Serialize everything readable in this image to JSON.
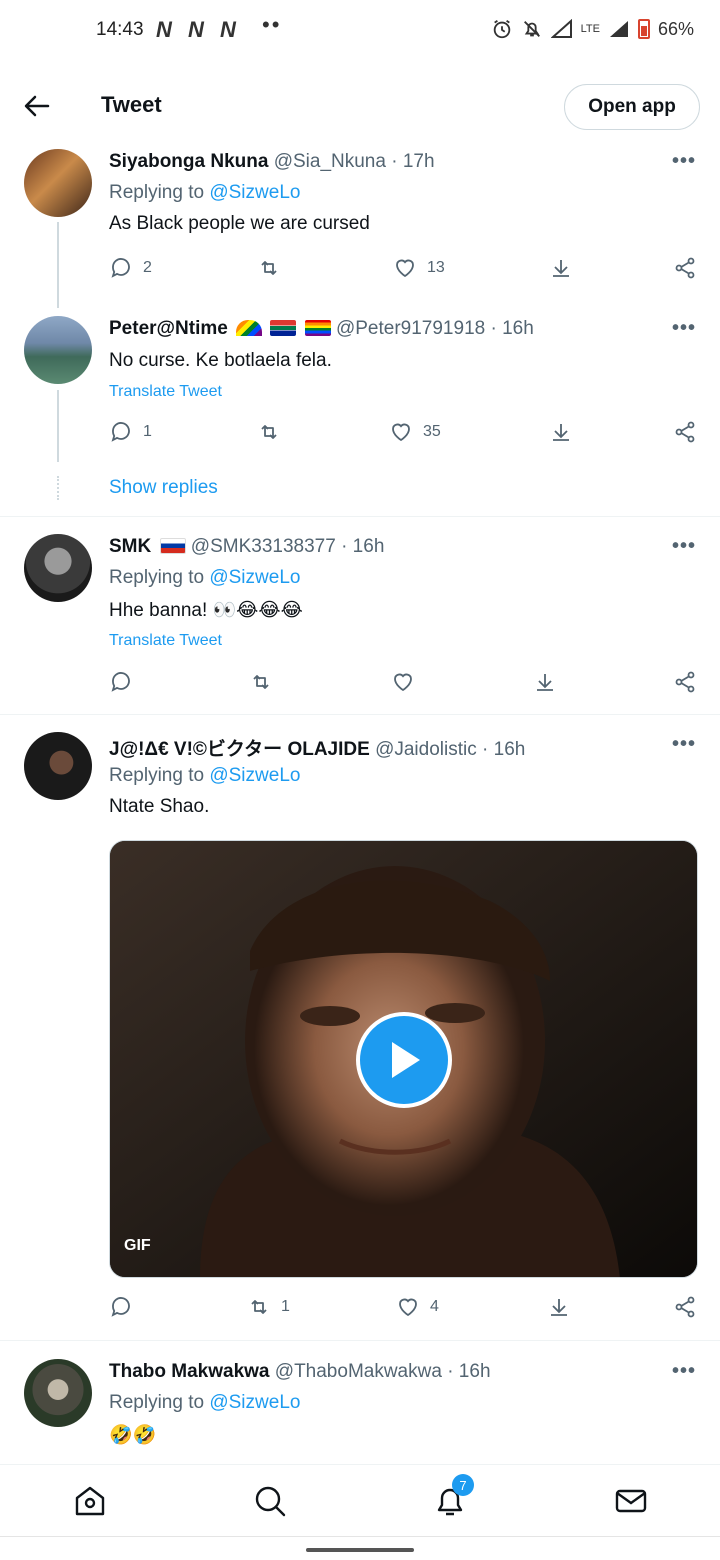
{
  "status_bar": {
    "time": "14:43",
    "network": "N",
    "dots": "••",
    "lte": "LTE",
    "battery": "66%"
  },
  "header": {
    "title": "Tweet",
    "open_app": "Open app"
  },
  "tweets": [
    {
      "name": "Siyabonga Nkuna",
      "handle": "@Sia_Nkuna",
      "time": "· 17h",
      "replying_prefix": "Replying to",
      "replying_to": "@SizweLo",
      "text": "As Black people we are cursed",
      "replies": "2",
      "retweets": "",
      "likes": "13"
    },
    {
      "name": "Peter@Ntime",
      "handle": "@Peter91791918",
      "time": "· 16h",
      "text": "No curse. Ke botlaela fela.",
      "translate": "Translate Tweet",
      "replies": "1",
      "retweets": "",
      "likes": "35",
      "show_replies": "Show replies"
    },
    {
      "name": "SMK",
      "handle": "@SMK33138377",
      "time": "· 16h",
      "replying_prefix": "Replying to",
      "replying_to": "@SizweLo",
      "text": "Hhe banna! 👀😂😂😂",
      "translate": "Translate Tweet",
      "replies": "",
      "retweets": "",
      "likes": ""
    },
    {
      "name": "J@!Δ€ V!©ビクター OLAJIDE",
      "handle": "@Jaidolistic",
      "time": "· 16h",
      "replying_prefix": "Replying to",
      "replying_to": "@SizweLo",
      "text": "Ntate Shao.",
      "media_badge": "GIF",
      "replies": "",
      "retweets": "1",
      "likes": "4"
    },
    {
      "name": "Thabo Makwakwa",
      "handle": "@ThaboMakwakwa",
      "time": "· 16h",
      "replying_prefix": "Replying to",
      "replying_to": "@SizweLo",
      "text": "🤣🤣"
    }
  ],
  "bottom_nav": {
    "notifications_badge": "7"
  },
  "colors": {
    "accent": "#1d9bf0",
    "secondary_text": "#536471",
    "border": "#cfd9de"
  }
}
